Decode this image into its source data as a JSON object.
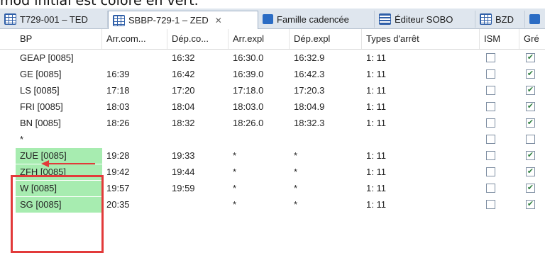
{
  "caption": "mod initial est coloré en vert.",
  "tabs": [
    {
      "label": "T729-001 – TED",
      "icon": "grid-icon",
      "active": false
    },
    {
      "label": "SBBP-729-1 – ZED",
      "icon": "grid-icon",
      "active": true
    },
    {
      "label": "Famille cadencée",
      "icon": "group-icon",
      "active": false
    },
    {
      "label": "Éditeur SOBO",
      "icon": "calendar-icon",
      "active": false
    },
    {
      "label": "BZD",
      "icon": "grid-icon",
      "active": false
    }
  ],
  "columns": [
    "BP",
    "Arr.com...",
    "Dép.co...",
    "Arr.expl",
    "Dép.expl",
    "Types d'arrêt",
    "ISM",
    "Gré"
  ],
  "rows": [
    {
      "bp": "GEAP [0085]",
      "arr_com": "",
      "dep_co": "16:32",
      "arr_expl": "16:30.0",
      "dep_expl": "16:32.9",
      "types": "1: 11",
      "ism": false,
      "gre": true,
      "green": false
    },
    {
      "bp": "GE [0085]",
      "arr_com": "16:39",
      "dep_co": "16:42",
      "arr_expl": "16:39.0",
      "dep_expl": "16:42.3",
      "types": "1: 11",
      "ism": false,
      "gre": true,
      "green": false
    },
    {
      "bp": "LS [0085]",
      "arr_com": "17:18",
      "dep_co": "17:20",
      "arr_expl": "17:18.0",
      "dep_expl": "17:20.3",
      "types": "1: 11",
      "ism": false,
      "gre": true,
      "green": false
    },
    {
      "bp": "FRI [0085]",
      "arr_com": "18:03",
      "dep_co": "18:04",
      "arr_expl": "18:03.0",
      "dep_expl": "18:04.9",
      "types": "1: 11",
      "ism": false,
      "gre": true,
      "green": false
    },
    {
      "bp": "BN [0085]",
      "arr_com": "18:26",
      "dep_co": "18:32",
      "arr_expl": "18:26.0",
      "dep_expl": "18:32.3",
      "types": "1: 11",
      "ism": false,
      "gre": true,
      "green": false
    },
    {
      "bp": "*",
      "arr_com": "",
      "dep_co": "",
      "arr_expl": "",
      "dep_expl": "",
      "types": "",
      "ism": false,
      "gre": false,
      "green": false
    },
    {
      "bp": "ZUE [0085]",
      "arr_com": "19:28",
      "dep_co": "19:33",
      "arr_expl": "*",
      "dep_expl": "*",
      "types": "1: 11",
      "ism": false,
      "gre": true,
      "green": true
    },
    {
      "bp": "ZFH [0085]",
      "arr_com": "19:42",
      "dep_co": "19:44",
      "arr_expl": "*",
      "dep_expl": "*",
      "types": "1: 11",
      "ism": false,
      "gre": true,
      "green": true
    },
    {
      "bp": "W [0085]",
      "arr_com": "19:57",
      "dep_co": "19:59",
      "arr_expl": "*",
      "dep_expl": "*",
      "types": "1: 11",
      "ism": false,
      "gre": true,
      "green": true
    },
    {
      "bp": "SG [0085]",
      "arr_com": "20:35",
      "dep_co": "",
      "arr_expl": "*",
      "dep_expl": "*",
      "types": "1: 11",
      "ism": false,
      "gre": true,
      "green": true
    }
  ],
  "colors": {
    "highlight_border": "#e23a3a",
    "green_cell": "#a7ecb0",
    "arrow": "#e23a3a"
  }
}
